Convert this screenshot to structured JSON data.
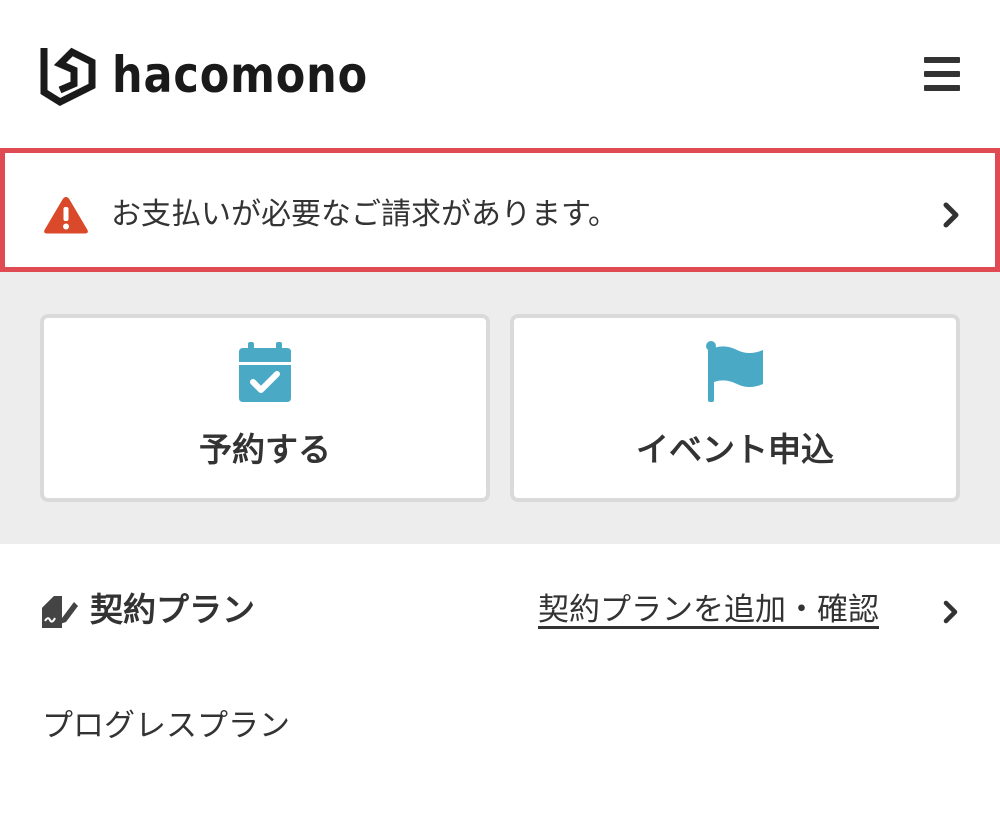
{
  "header": {
    "logo_text": "hacomono",
    "menu_icon": "hamburger-menu-icon"
  },
  "alert": {
    "icon": "warning-triangle-icon",
    "text": "お支払いが必要なご請求があります。",
    "chevron_icon": "chevron-right-icon",
    "border_color": "#e04a52",
    "icon_color": "#d9492a"
  },
  "actions": {
    "items": [
      {
        "label": "予約する",
        "icon": "calendar-check-icon"
      },
      {
        "label": "イベント申込",
        "icon": "flag-icon"
      }
    ],
    "icon_color": "#4aaac6"
  },
  "plan": {
    "icon": "contract-sign-icon",
    "title": "契約プラン",
    "link_label": "契約プランを追加・確認",
    "link_chevron_icon": "chevron-right-icon",
    "current_plan": "プログレスプラン"
  }
}
